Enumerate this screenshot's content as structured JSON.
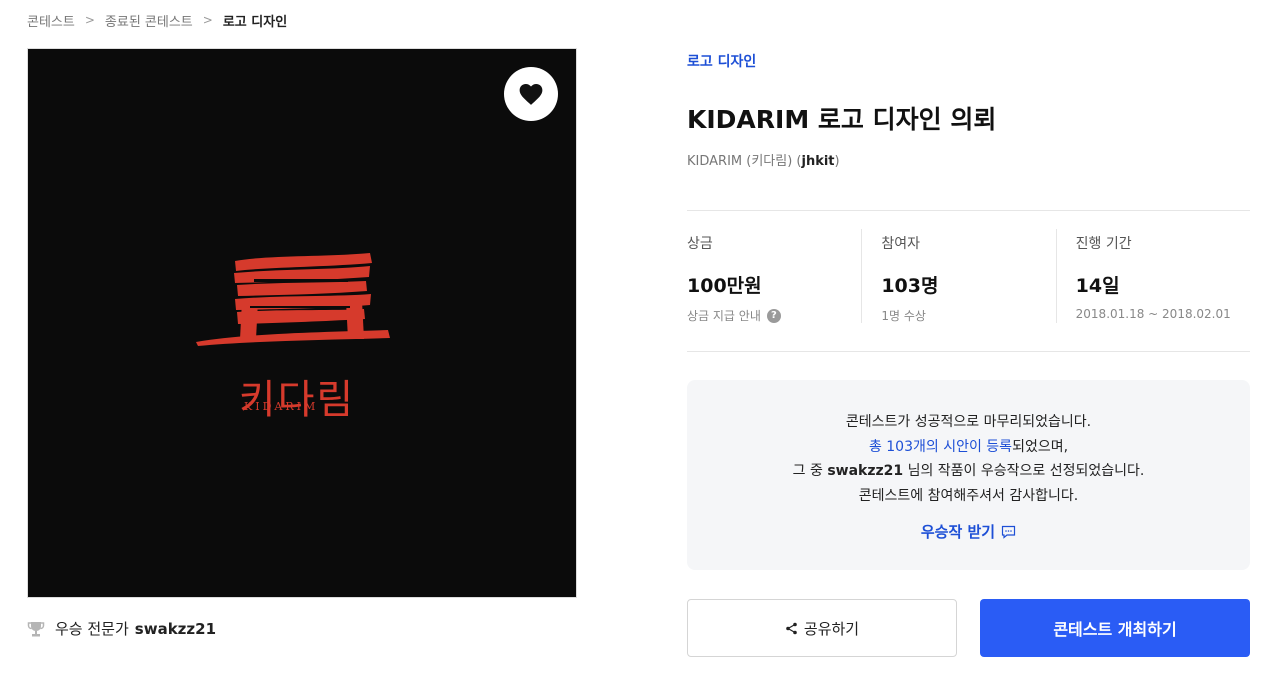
{
  "breadcrumb": {
    "items": [
      "콘테스트",
      "종료된 콘테스트"
    ],
    "current": "로고 디자인",
    "separator": ">"
  },
  "artwork": {
    "logo_ko": "키다림",
    "logo_en": "KIDARIM",
    "background_color": "#0b0b0b",
    "logo_color": "#d63a2c",
    "like_icon": "heart-icon"
  },
  "winner": {
    "icon": "trophy-icon",
    "label": "우승 전문가",
    "name": "swakzz21"
  },
  "contest": {
    "category": "로고 디자인",
    "title": "KIDARIM 로고 디자인 의뢰",
    "host_name": "KIDARIM (키다림) (",
    "host_id": "jhkit",
    "host_close": ")"
  },
  "stats": {
    "prize": {
      "label": "상금",
      "value": "100만원",
      "sub": "상금 지급 안내",
      "help_icon": "?"
    },
    "participants": {
      "label": "참여자",
      "value": "103명",
      "sub": "1명 수상"
    },
    "period": {
      "label": "진행 기간",
      "value": "14일",
      "sub": "2018.01.18 ~ 2018.02.01"
    }
  },
  "notice": {
    "line1": "콘테스트가 성공적으로 마무리되었습니다.",
    "line2_link": "총 103개의 시안이 등록",
    "line2_rest": "되었으며,",
    "line3_pre": "그 중 ",
    "line3_name": "swakzz21",
    "line3_rest": " 님의 작품이 우승작으로 선정되었습니다.",
    "line4": "콘테스트에 참여해주셔서 감사합니다.",
    "get_winner_label": "우승작 받기",
    "get_winner_icon": "message-icon"
  },
  "buttons": {
    "share_label": "공유하기",
    "share_icon": "share-icon",
    "host_label": "콘테스트 개최하기"
  },
  "colors": {
    "accent_blue": "#2a5cf5",
    "link_blue": "#1d4fd6",
    "notice_bg": "#f5f6f8"
  }
}
